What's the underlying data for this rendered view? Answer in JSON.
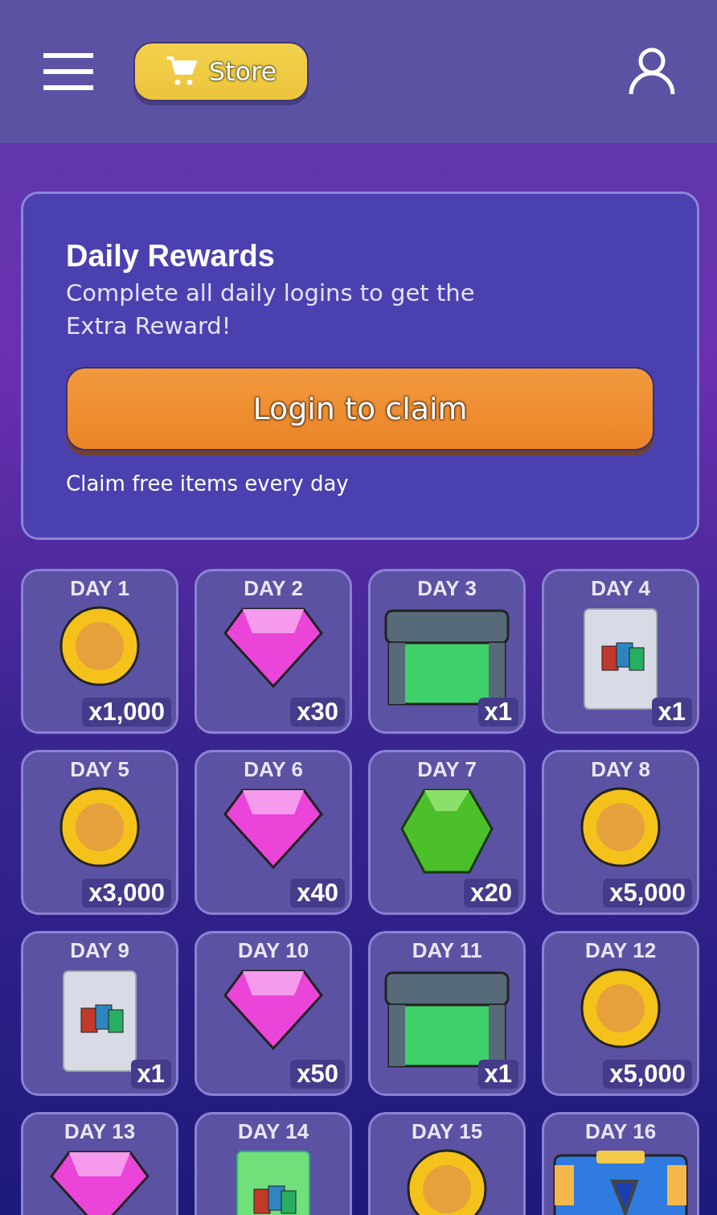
{
  "header": {
    "store_label": "Store"
  },
  "rewards_card": {
    "title": "Daily Rewards",
    "subtitle": "Complete all daily logins to get the Extra Reward!",
    "button": "Login to claim",
    "note": "Claim free items every day"
  },
  "days": [
    {
      "label": "DAY 1",
      "kind": "coin",
      "amount": "x1,000"
    },
    {
      "label": "DAY 2",
      "kind": "gem",
      "amount": "x30"
    },
    {
      "label": "DAY 3",
      "kind": "chest",
      "amount": "x1"
    },
    {
      "label": "DAY 4",
      "kind": "pack",
      "amount": "x1"
    },
    {
      "label": "DAY 5",
      "kind": "coin",
      "amount": "x3,000"
    },
    {
      "label": "DAY 6",
      "kind": "gem",
      "amount": "x40"
    },
    {
      "label": "DAY 7",
      "kind": "emerald",
      "amount": "x20"
    },
    {
      "label": "DAY 8",
      "kind": "coin",
      "amount": "x5,000"
    },
    {
      "label": "DAY 9",
      "kind": "pack",
      "amount": "x1"
    },
    {
      "label": "DAY 10",
      "kind": "gem",
      "amount": "x50"
    },
    {
      "label": "DAY 11",
      "kind": "chest",
      "amount": "x1"
    },
    {
      "label": "DAY 12",
      "kind": "coin",
      "amount": "x5,000"
    },
    {
      "label": "DAY 13",
      "kind": "gem"
    },
    {
      "label": "DAY 14",
      "kind": "greenpack"
    },
    {
      "label": "DAY 15",
      "kind": "coin"
    },
    {
      "label": "DAY 16",
      "kind": "bigchest"
    }
  ]
}
